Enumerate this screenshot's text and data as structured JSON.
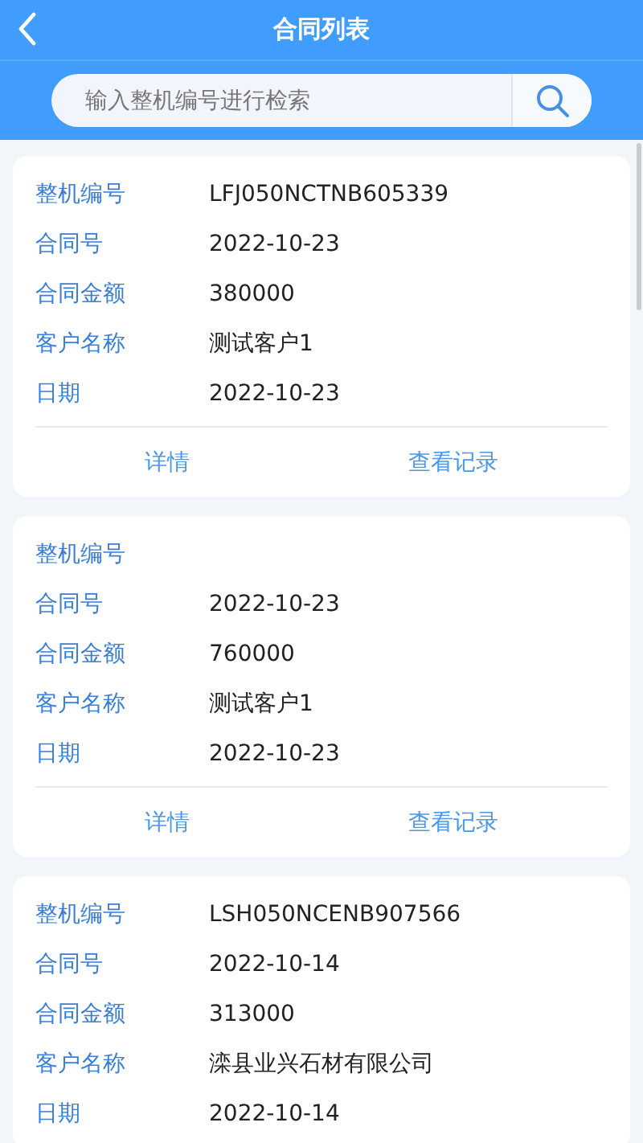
{
  "header": {
    "title": "合同列表"
  },
  "search": {
    "placeholder": "输入整机编号进行检索"
  },
  "cards": [
    {
      "fields": [
        {
          "label": "整机编号",
          "value": "LFJ050NCTNB605339"
        },
        {
          "label": "合同号",
          "value": "2022-10-23"
        },
        {
          "label": "合同金额",
          "value": "380000"
        },
        {
          "label": "客户名称",
          "value": "测试客户1"
        },
        {
          "label": "日期",
          "value": "2022-10-23"
        }
      ],
      "actions": [
        "详情",
        "查看记录"
      ]
    },
    {
      "fields": [
        {
          "label": "整机编号"
        },
        {
          "label": "合同号",
          "value": "2022-10-23"
        },
        {
          "label": "合同金额",
          "value": "760000"
        },
        {
          "label": "客户名称",
          "value": "测试客户1"
        },
        {
          "label": "日期",
          "value": "2022-10-23"
        }
      ],
      "actions": [
        "详情",
        "查看记录"
      ]
    },
    {
      "fields": [
        {
          "label": "整机编号",
          "value": "LSH050NCENB907566"
        },
        {
          "label": "合同号",
          "value": "2022-10-14"
        },
        {
          "label": "合同金额",
          "value": "313000"
        },
        {
          "label": "客户名称",
          "value": "滦县业兴石材有限公司"
        },
        {
          "label": "日期",
          "value": "2022-10-14"
        }
      ]
    }
  ]
}
